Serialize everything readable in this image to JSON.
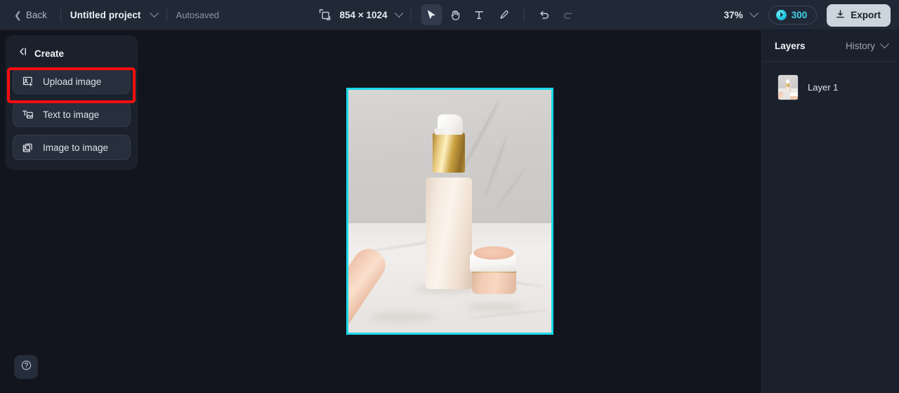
{
  "topbar": {
    "back_label": "Back",
    "project_name": "Untitled project",
    "autosaved_label": "Autosaved",
    "canvas_size": "854 × 1024",
    "zoom_level": "37%",
    "credits": "300",
    "export_label": "Export",
    "tools": [
      {
        "name": "select-tool",
        "label": "Select",
        "active": true
      },
      {
        "name": "hand-tool",
        "label": "Hand",
        "active": false
      },
      {
        "name": "text-tool",
        "label": "Text",
        "active": false
      },
      {
        "name": "brush-tool",
        "label": "Brush",
        "active": false
      },
      {
        "name": "undo-button",
        "label": "Undo",
        "active": false
      },
      {
        "name": "redo-button",
        "label": "Redo",
        "active": false
      }
    ]
  },
  "create_panel": {
    "title": "Create",
    "collapse_icon": "collapse-panel-icon",
    "buttons": [
      {
        "icon": "upload-image-icon",
        "label": "Upload image",
        "highlighted": true
      },
      {
        "icon": "text-to-image-icon",
        "label": "Text to image",
        "highlighted": false
      },
      {
        "icon": "image-to-image-icon",
        "label": "Image to image",
        "highlighted": false
      }
    ]
  },
  "annotation": {
    "color": "#fb0d10",
    "target": "Upload image"
  },
  "layers_panel": {
    "tab_layers": "Layers",
    "tab_history": "History",
    "layers": [
      {
        "name": "Layer 1"
      }
    ]
  },
  "canvas": {
    "selection_color": "#18d8e8",
    "image_description": "Cosmetic product photo: cream pump bottle with gold collar, peach tube and cream jar on white marble"
  },
  "help": {
    "icon": "help-circle-icon",
    "label": "Help"
  }
}
